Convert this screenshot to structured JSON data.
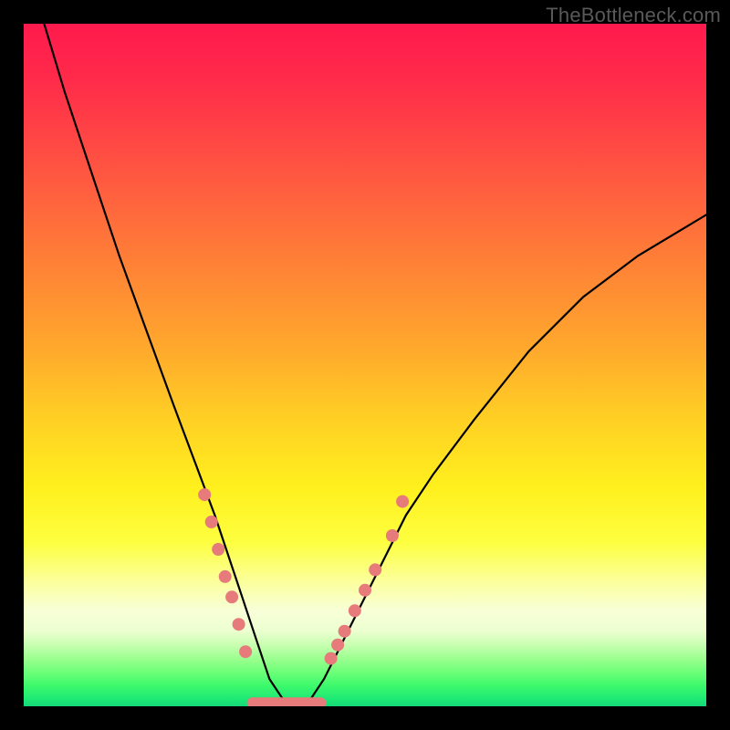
{
  "watermark": "TheBottleneck.com",
  "chart_data": {
    "type": "line",
    "title": "",
    "xlabel": "",
    "ylabel": "",
    "xlim": [
      0,
      100
    ],
    "ylim": [
      0,
      100
    ],
    "grid": false,
    "legend": false,
    "description": "V-shaped bottleneck curve on red-to-green gradient; minimum near x≈37 at y≈0; left branch steep from top-left, right branch rises to ~y≈72 at x=100.",
    "series": [
      {
        "name": "bottleneck-curve",
        "x": [
          3,
          6,
          10,
          14,
          18,
          22,
          25,
          28,
          30,
          32,
          34,
          36,
          38,
          40,
          42,
          44,
          46,
          48,
          52,
          56,
          60,
          66,
          74,
          82,
          90,
          100
        ],
        "y": [
          100,
          90,
          78,
          66,
          55,
          44,
          36,
          28,
          22,
          16,
          10,
          4,
          1,
          0,
          1,
          4,
          8,
          12,
          20,
          28,
          34,
          42,
          52,
          60,
          66,
          72
        ]
      }
    ],
    "markers_left": {
      "name": "left-branch-dots",
      "x": [
        26.5,
        27.5,
        28.5,
        29.5,
        30.5,
        31.5,
        32.5
      ],
      "y": [
        31,
        27,
        23,
        19,
        16,
        12,
        8
      ]
    },
    "markers_right": {
      "name": "right-branch-dots",
      "x": [
        45,
        46,
        47,
        48.5,
        50,
        51.5,
        54,
        55.5
      ],
      "y": [
        7,
        9,
        11,
        14,
        17,
        20,
        25,
        30
      ]
    },
    "baseline_segment": {
      "name": "valley-floor",
      "x_start": 33.5,
      "x_end": 43.5,
      "y": 0.5
    },
    "gradient_stops": [
      {
        "pos": 0.0,
        "color": "#ff1a4d"
      },
      {
        "pos": 0.28,
        "color": "#ff6a3c"
      },
      {
        "pos": 0.58,
        "color": "#ffd024"
      },
      {
        "pos": 0.76,
        "color": "#fdff40"
      },
      {
        "pos": 0.86,
        "color": "#f8ffd8"
      },
      {
        "pos": 0.95,
        "color": "#6cff78"
      },
      {
        "pos": 1.0,
        "color": "#14d977"
      }
    ]
  }
}
